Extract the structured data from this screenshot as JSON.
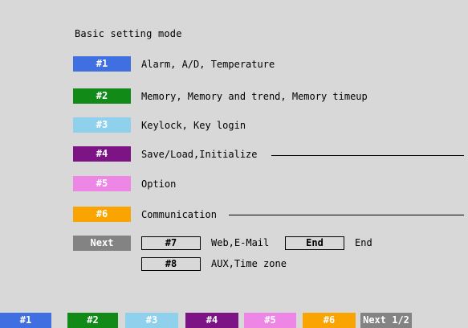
{
  "title": "Basic setting mode",
  "menu": [
    {
      "key": "#1",
      "label": "Alarm, A/D, Temperature",
      "color": "#3f6fe0",
      "line": false
    },
    {
      "key": "#2",
      "label": "Memory, Memory and trend, Memory timeup",
      "color": "#118a18",
      "line": false
    },
    {
      "key": "#3",
      "label": "Keylock, Key login",
      "color": "#8fd0ec",
      "line": false
    },
    {
      "key": "#4",
      "label": "Save/Load,Initialize",
      "color": "#7d1486",
      "line": true
    },
    {
      "key": "#5",
      "label": "Option",
      "color": "#ee86e6",
      "line": false
    },
    {
      "key": "#6",
      "label": "Communication",
      "color": "#f9a400",
      "line": true
    }
  ],
  "next_row": {
    "next_label": "Next",
    "next_color": "#838383",
    "k7": "#7",
    "k7_label": "Web,E-Mail",
    "end_key": "End",
    "end_label": "End",
    "k8": "#8",
    "k8_label": "AUX,Time zone"
  },
  "softkeys": [
    {
      "label": "#1",
      "color": "#3f6fe0"
    },
    {
      "label": "#2",
      "color": "#118a18"
    },
    {
      "label": "#3",
      "color": "#8fd0ec"
    },
    {
      "label": "#4",
      "color": "#7d1486"
    },
    {
      "label": "#5",
      "color": "#ee86e6"
    },
    {
      "label": "#6",
      "color": "#f9a400"
    },
    {
      "label": "Next 1/2",
      "color": "#838383"
    }
  ]
}
